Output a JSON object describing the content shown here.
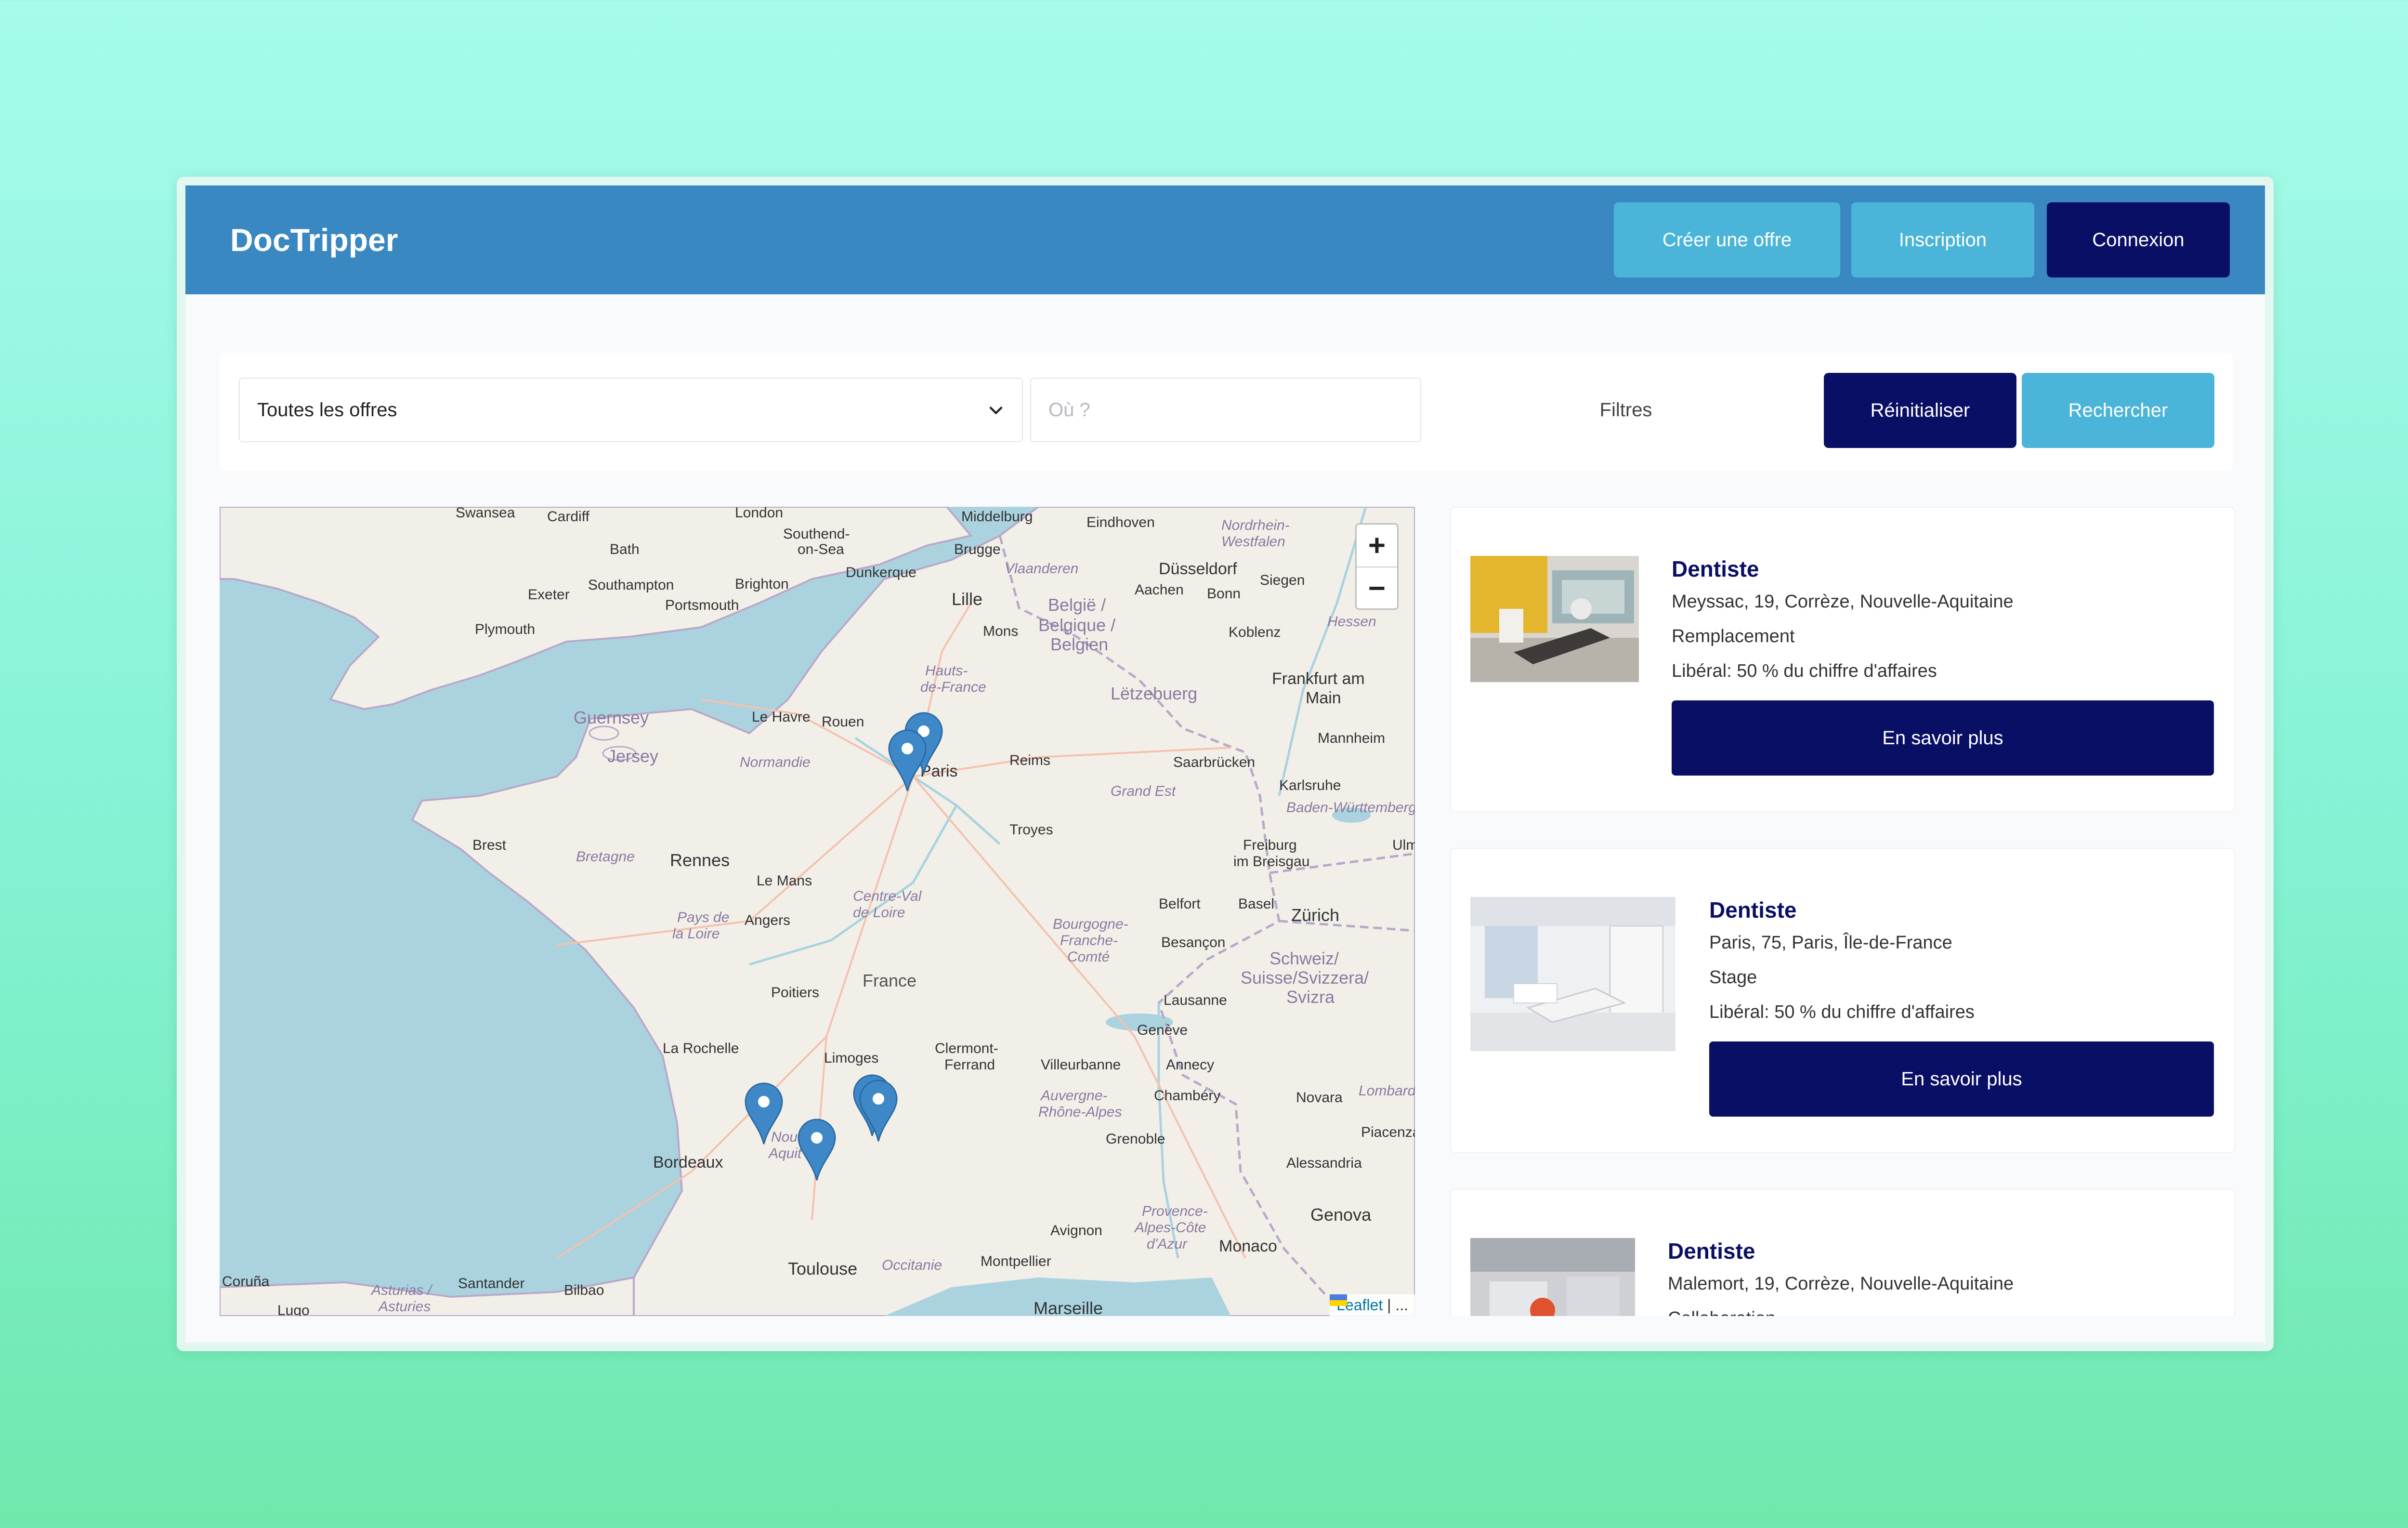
{
  "header": {
    "brand": "DocTripper",
    "buttons": {
      "create_offer": "Créer une offre",
      "signup": "Inscription",
      "login": "Connexion"
    }
  },
  "search": {
    "offer_select": {
      "selected": "Toutes les offres"
    },
    "where": {
      "placeholder": "Où ?",
      "value": ""
    },
    "filters_label": "Filtres",
    "reset_label": "Réinitialiser",
    "search_label": "Rechercher"
  },
  "map": {
    "zoom_in": "+",
    "zoom_out": "−",
    "attribution": {
      "leaflet": "Leaflet",
      "rest": "| ..."
    },
    "labels": {
      "swansea": "Swansea",
      "cardiff": "Cardiff",
      "london": "London",
      "southend": "Southend-",
      "onsea": "on-Sea",
      "middelburg": "Middelburg",
      "eindhoven": "Eindhoven",
      "nordrhein": "Nordrhein-",
      "westfalen": "Westfalen",
      "bath": "Bath",
      "brugge": "Brugge",
      "dusseldorf": "Düsseldorf",
      "dunkerque": "Dunkerque",
      "vlaanderen": "Vlaanderen",
      "exeter": "Exeter",
      "southampton": "Southampton",
      "brighton": "Brighton",
      "portsmouth": "Portsmouth",
      "aachen": "Aachen",
      "bonn": "Bonn",
      "siegen": "Siegen",
      "lille": "Lille",
      "belgie": "België /",
      "belgique": "Belgique /",
      "belgien": "Belgien",
      "mons": "Mons",
      "koblenz": "Koblenz",
      "hessen": "Hessen",
      "plymouth": "Plymouth",
      "hautsdefrance1": "Hauts-",
      "hautsdefrance2": "de-France",
      "frankfurt1": "Frankfurt am",
      "frankfurt2": "Main",
      "letzebuerg": "Lëtzebuerg",
      "guernsey": "Guernsey",
      "lehavre": "Le Havre",
      "rouen": "Rouen",
      "mannheim": "Mannheim",
      "jersey": "Jersey",
      "normandie": "Normandie",
      "paris": "Paris",
      "reims": "Reims",
      "saarbrucken": "Saarbrücken",
      "karlsruhe": "Karlsruhe",
      "grandest": "Grand Est",
      "badenwurttemberg": "Baden-Württemberg",
      "troyes": "Troyes",
      "brest": "Brest",
      "freiburg1": "Freiburg",
      "freiburg2": "im Breisgau",
      "ulm": "Ulm",
      "bretagne": "Bretagne",
      "rennes": "Rennes",
      "lemans": "Le Mans",
      "centreval1": "Centre-Val",
      "centreval2": "de Loire",
      "belfort": "Belfort",
      "basel": "Basel",
      "zurich": "Zürich",
      "angers": "Angers",
      "paysdelaloire1": "Pays de",
      "paysdelaloire2": "la Loire",
      "bourgogne1": "Bourgogne-",
      "bourgogne2": "Franche-",
      "bourgogne3": "Comté",
      "besancon": "Besançon",
      "schweiz1": "Schweiz/",
      "schweiz2": "Suisse/Svizzera/",
      "schweiz3": "Svizra",
      "poitiers": "Poitiers",
      "france": "France",
      "lausanne": "Lausanne",
      "geneve": "Genève",
      "larochelle": "La Rochelle",
      "limoges": "Limoges",
      "clermont1": "Clermont-",
      "clermont2": "Ferrand",
      "villeurbanne": "Villeurbanne",
      "annecy": "Annecy",
      "chambery": "Chambéry",
      "novara": "Novara",
      "lombardia": "Lombardia",
      "auvergne1": "Auvergne-",
      "auvergne2": "Rhône-Alpes",
      "piacenza": "Piacenza",
      "nouvelle": "Nouv",
      "aquit": "Aquit",
      "grenoble": "Grenoble",
      "bordeaux": "Bordeaux",
      "alessandria": "Alessandria",
      "provence1": "Provence-",
      "provence2": "Alpes-Côte",
      "provence3": "d'Azur",
      "genova": "Genova",
      "avignon": "Avignon",
      "monaco": "Monaco",
      "toulouse": "Toulouse",
      "occitanie": "Occitanie",
      "montpellier": "Montpellier",
      "coruna": "Coruña",
      "santander": "Santander",
      "bilbao": "Bilbao",
      "asturias1": "Asturias /",
      "asturias2": "Asturies",
      "lugo": "Lugo",
      "marseille": "Marseille"
    }
  },
  "results": [
    {
      "title": "Dentiste",
      "location": "Meyssac, 19, Corrèze, Nouvelle-Aquitaine",
      "type": "Remplacement",
      "terms": "Libéral: 50 % du chiffre d'affaires",
      "button": "En savoir plus"
    },
    {
      "title": "Dentiste",
      "location": "Paris, 75, Paris, Île-de-France",
      "type": "Stage",
      "terms": "Libéral: 50 % du chiffre d'affaires",
      "button": "En savoir plus"
    },
    {
      "title": "Dentiste",
      "location": "Malemort, 19, Corrèze, Nouvelle-Aquitaine",
      "type": "Collaboration"
    }
  ],
  "colors": {
    "header": "#3a88c1",
    "primary_dark": "#0a0f66",
    "accent_light": "#4ab5d9",
    "marker": "#3e88c8"
  }
}
